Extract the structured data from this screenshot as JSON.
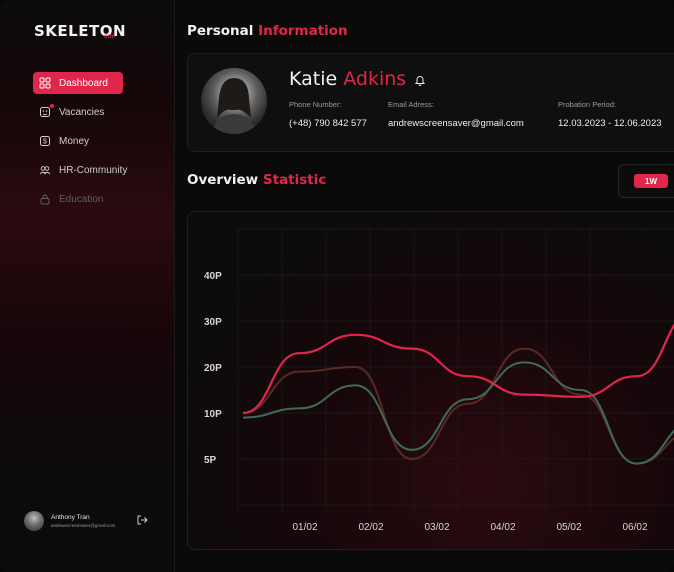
{
  "app": {
    "logo": "SKELETON",
    "logo_sub": "crm"
  },
  "sidebar": {
    "items": [
      {
        "label": "Dashboard",
        "icon": "grid-icon",
        "active": true
      },
      {
        "label": "Vacancies",
        "icon": "vacancies-icon",
        "badge": true
      },
      {
        "label": "Money",
        "icon": "dollar-icon"
      },
      {
        "label": "HR-Community",
        "icon": "community-icon"
      },
      {
        "label": "Education",
        "icon": "lock-icon",
        "disabled": true
      }
    ]
  },
  "user": {
    "name": "Anthony Tran",
    "email": "andrewscreensaver@gmail.com"
  },
  "personal": {
    "title_main": "Personal",
    "title_accent": "Information",
    "first_name": "Katie",
    "last_name": "Adkins",
    "phone_label": "Phone Number:",
    "phone": "(+48) 790 842 577",
    "email_label": "Email Adress:",
    "email": "andrewscreensaver@gmail.com",
    "probation_label": "Probation Period:",
    "probation": "12.03.2023  -  12.06.2023"
  },
  "overview": {
    "title_main": "Overview",
    "title_accent": "Statistic",
    "period_selected": "1W"
  },
  "colors": {
    "accent": "#e0264a",
    "green": "#3f6b57",
    "brown": "#5a2a22"
  },
  "chart_data": {
    "type": "line",
    "x": [
      "01/02",
      "02/02",
      "03/02",
      "04/02",
      "05/02",
      "06/02"
    ],
    "y_ticks": [
      "5P",
      "10P",
      "20P",
      "30P",
      "40P"
    ],
    "grid": true,
    "series": [
      {
        "color": "#e0264a",
        "values": [
          10,
          23,
          27,
          24,
          18,
          14,
          13.5,
          18,
          32
        ]
      },
      {
        "color": "#3f6b57",
        "values": [
          9.5,
          11,
          16,
          6,
          13,
          21,
          15,
          4.5,
          9
        ]
      },
      {
        "color": "#5a2a22",
        "values": [
          10,
          19,
          20,
          5,
          12,
          24,
          14,
          4.5,
          8
        ]
      }
    ]
  }
}
